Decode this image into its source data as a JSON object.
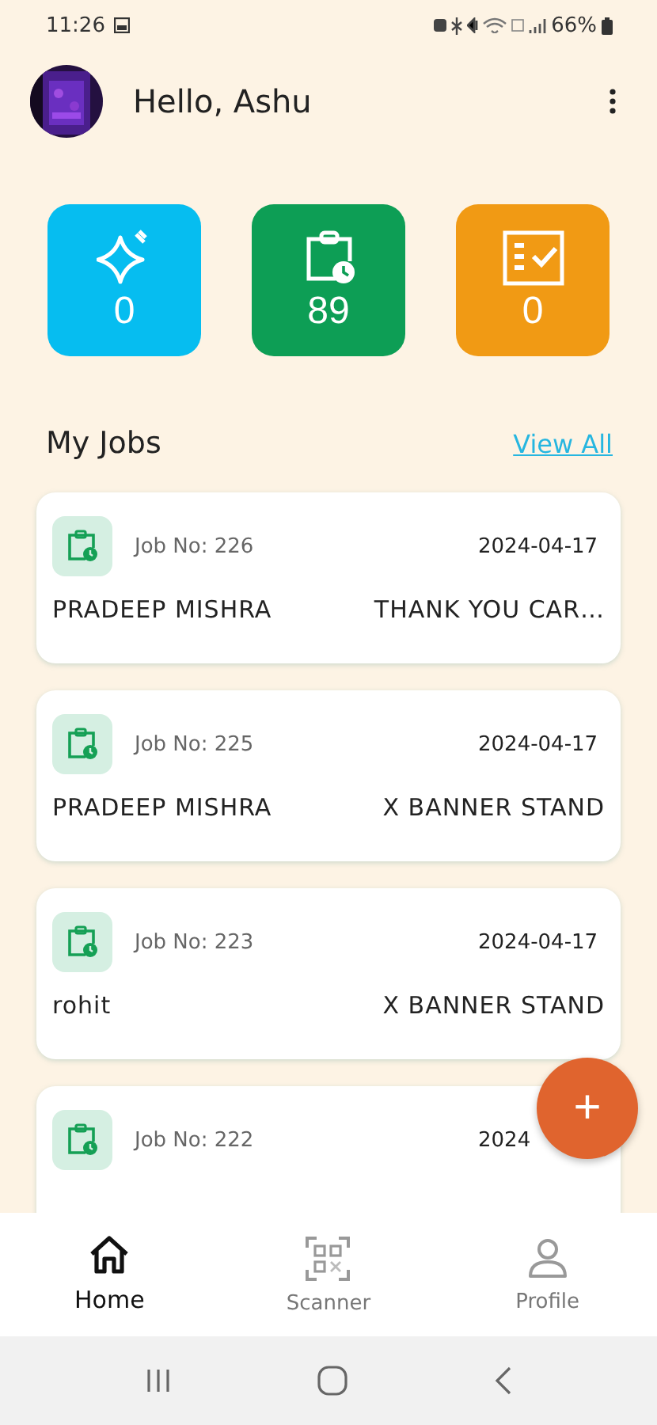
{
  "status_bar": {
    "time": "11:26",
    "battery": "66%"
  },
  "header": {
    "greeting": "Hello, Ashu"
  },
  "stats": [
    {
      "kind": "sparkle",
      "value": "0",
      "color": "#06bdf0"
    },
    {
      "kind": "clipboard",
      "value": "89",
      "color": "#0d9e55"
    },
    {
      "kind": "checklist",
      "value": "0",
      "color": "#f19a14"
    }
  ],
  "section": {
    "title": "My Jobs",
    "link": "View All"
  },
  "jobs": [
    {
      "job_no": "Job No: 226",
      "date": "2024-04-17",
      "customer": "PRADEEP MISHRA",
      "item": "THANK YOU CAR…"
    },
    {
      "job_no": "Job No: 225",
      "date": "2024-04-17",
      "customer": "PRADEEP MISHRA",
      "item": "X BANNER STAND"
    },
    {
      "job_no": "Job No: 223",
      "date": "2024-04-17",
      "customer": "rohit",
      "item": "X BANNER STAND"
    },
    {
      "job_no": "Job No: 222",
      "date": "2024"
    }
  ],
  "fab": {
    "label": "+"
  },
  "bottom_nav": [
    {
      "kind": "home",
      "label": "Home",
      "selected": true
    },
    {
      "kind": "scanner",
      "label": "Scanner",
      "selected": false
    },
    {
      "kind": "profile",
      "label": "Profile",
      "selected": false
    }
  ]
}
